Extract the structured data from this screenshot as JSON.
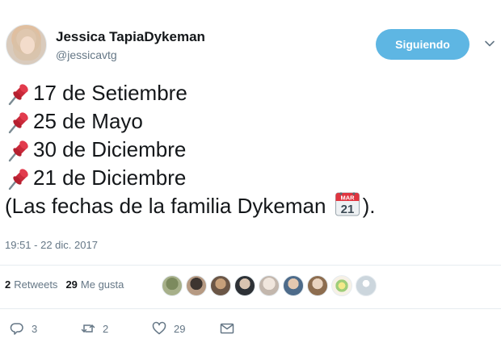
{
  "user": {
    "display_name": "Jessica TapiaDykeman",
    "handle": "@jessicavtg",
    "avatar_icon": "profile-photo"
  },
  "follow_button": {
    "label": "Siguiendo",
    "color": "#5eb6e3"
  },
  "menu_icon": "chevron-down-icon",
  "tweet": {
    "lines": [
      {
        "icon": "pushpin-icon",
        "text": "17 de Setiembre"
      },
      {
        "icon": "pushpin-icon",
        "text": "25 de Mayo"
      },
      {
        "icon": "pushpin-icon",
        "text": "30 de Diciembre"
      },
      {
        "icon": "pushpin-icon",
        "text": "21 de Diciembre"
      }
    ],
    "closing_before": "(Las fechas de la familia Dykeman ",
    "closing_icon": "calendar-icon",
    "closing_after": ").",
    "calendar_month": "MAR",
    "calendar_day": "21"
  },
  "timestamp": "19:51 - 22 dic. 2017",
  "stats": {
    "retweets_count": "2",
    "retweets_label": "Retweets",
    "likes_count": "29",
    "likes_label": "Me gusta"
  },
  "actions": {
    "reply_count": "3",
    "retweet_count": "2",
    "like_count": "29"
  },
  "colors": {
    "secondary_text": "#657786",
    "divider": "#e6ecf0",
    "pin_red": "#d32f3f"
  }
}
